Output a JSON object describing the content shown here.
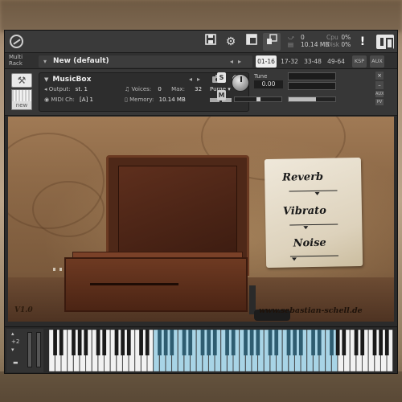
{
  "toolbar": {
    "save_icon": "save-icon",
    "gear_icon": "gear-icon",
    "view_icon": "view-icon",
    "resize_icon": "resize-icon",
    "midi_count": "0",
    "memory": "10.14 MB",
    "cpu_label": "Cpu",
    "cpu_value": "0%",
    "disk_label": "Disk",
    "disk_value": "0%",
    "warning": "!"
  },
  "rack": {
    "label_line1": "Multi",
    "label_line2": "Rack",
    "name": "New (default)",
    "page_tabs": [
      "01-16",
      "17-32",
      "33-48",
      "49-64",
      "KSP",
      "AUX"
    ],
    "active_tab": "01-16"
  },
  "instrument": {
    "name": "MusicBox",
    "new_label": "new",
    "output_label": "Output:",
    "output_value": "st. 1",
    "voices_label": "Voices:",
    "voices_value": "0",
    "max_label": "Max:",
    "max_value": "32",
    "purge_label": "Purge",
    "midi_label": "MIDI Ch:",
    "midi_value": "[A]  1",
    "memory_label": "Memory:",
    "memory_value": "10.14 MB",
    "solo": "S",
    "mute": "M",
    "tune_label": "Tune",
    "tune_value": "0.00",
    "side": [
      "AUX",
      "PV"
    ]
  },
  "body": {
    "effects": [
      "Reverb",
      "Vibrato",
      "Noise"
    ],
    "version": "V1.0",
    "url": "www.sebastian-schell.de"
  },
  "keyboard": {
    "octave": "+2",
    "highlight_start_white": 17,
    "highlight_end_white": 47,
    "white_keys": 56
  }
}
